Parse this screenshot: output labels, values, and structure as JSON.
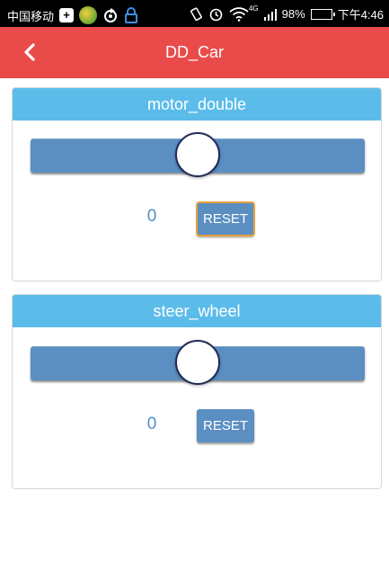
{
  "status_bar": {
    "carrier": "中国移动",
    "battery": "98%",
    "time": "下午4:46",
    "network": "4G"
  },
  "app_bar": {
    "title": "DD_Car"
  },
  "cards": [
    {
      "title": "motor_double",
      "value": "0",
      "slider_level": 0.5,
      "reset_label": "RESET"
    },
    {
      "title": "steer_wheel",
      "value": "0",
      "slider_level": 0.5,
      "reset_label": "RESET"
    }
  ],
  "colors": {
    "header": "#e94b4b",
    "card_header": "#5bbcea",
    "slider": "#5b8fc2",
    "focus_outline": "#e9a13a"
  }
}
